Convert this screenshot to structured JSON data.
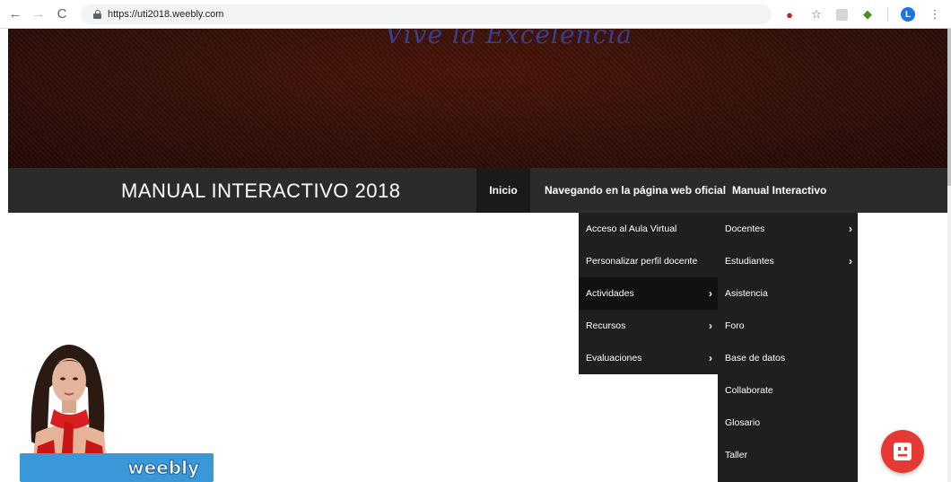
{
  "browser": {
    "url": "https://uti2018.weebly.com",
    "profile_initial": "L"
  },
  "banner": {
    "tagline": "Vive la Excelencia"
  },
  "site": {
    "title": "MANUAL INTERACTIVO 2018",
    "nav": [
      {
        "label": "Inicio",
        "active": true
      },
      {
        "label": "Navegando en la página web oficial",
        "active": false
      },
      {
        "label": "Manual Interactivo",
        "active": false
      }
    ]
  },
  "dropdown_level1": {
    "items": [
      {
        "label": "Acceso al Aula Virtual",
        "has_submenu": false
      },
      {
        "label": "Personalizar perfil docente",
        "has_submenu": false
      },
      {
        "label": "Actividades",
        "has_submenu": true,
        "hover": true
      },
      {
        "label": "Recursos",
        "has_submenu": true
      },
      {
        "label": "Evaluaciones",
        "has_submenu": true
      }
    ]
  },
  "dropdown_level2": {
    "items": [
      {
        "label": "Docentes",
        "has_submenu": true
      },
      {
        "label": "Estudiantes",
        "has_submenu": true
      },
      {
        "label": "Asistencia",
        "has_submenu": false
      },
      {
        "label": "Foro",
        "has_submenu": false
      },
      {
        "label": "Base de datos",
        "has_submenu": false
      },
      {
        "label": "Collaborate",
        "has_submenu": false
      },
      {
        "label": "Glosario",
        "has_submenu": false
      },
      {
        "label": "Taller",
        "has_submenu": false
      }
    ]
  },
  "arrow_glyph": "›",
  "weebly_badge": {
    "label": "weebly"
  },
  "colors": {
    "nav_bar": "#2b2b2b",
    "dropdown": "#1f1f1f",
    "badge_blue": "#3a97d8",
    "chat_red": "#e53935"
  }
}
